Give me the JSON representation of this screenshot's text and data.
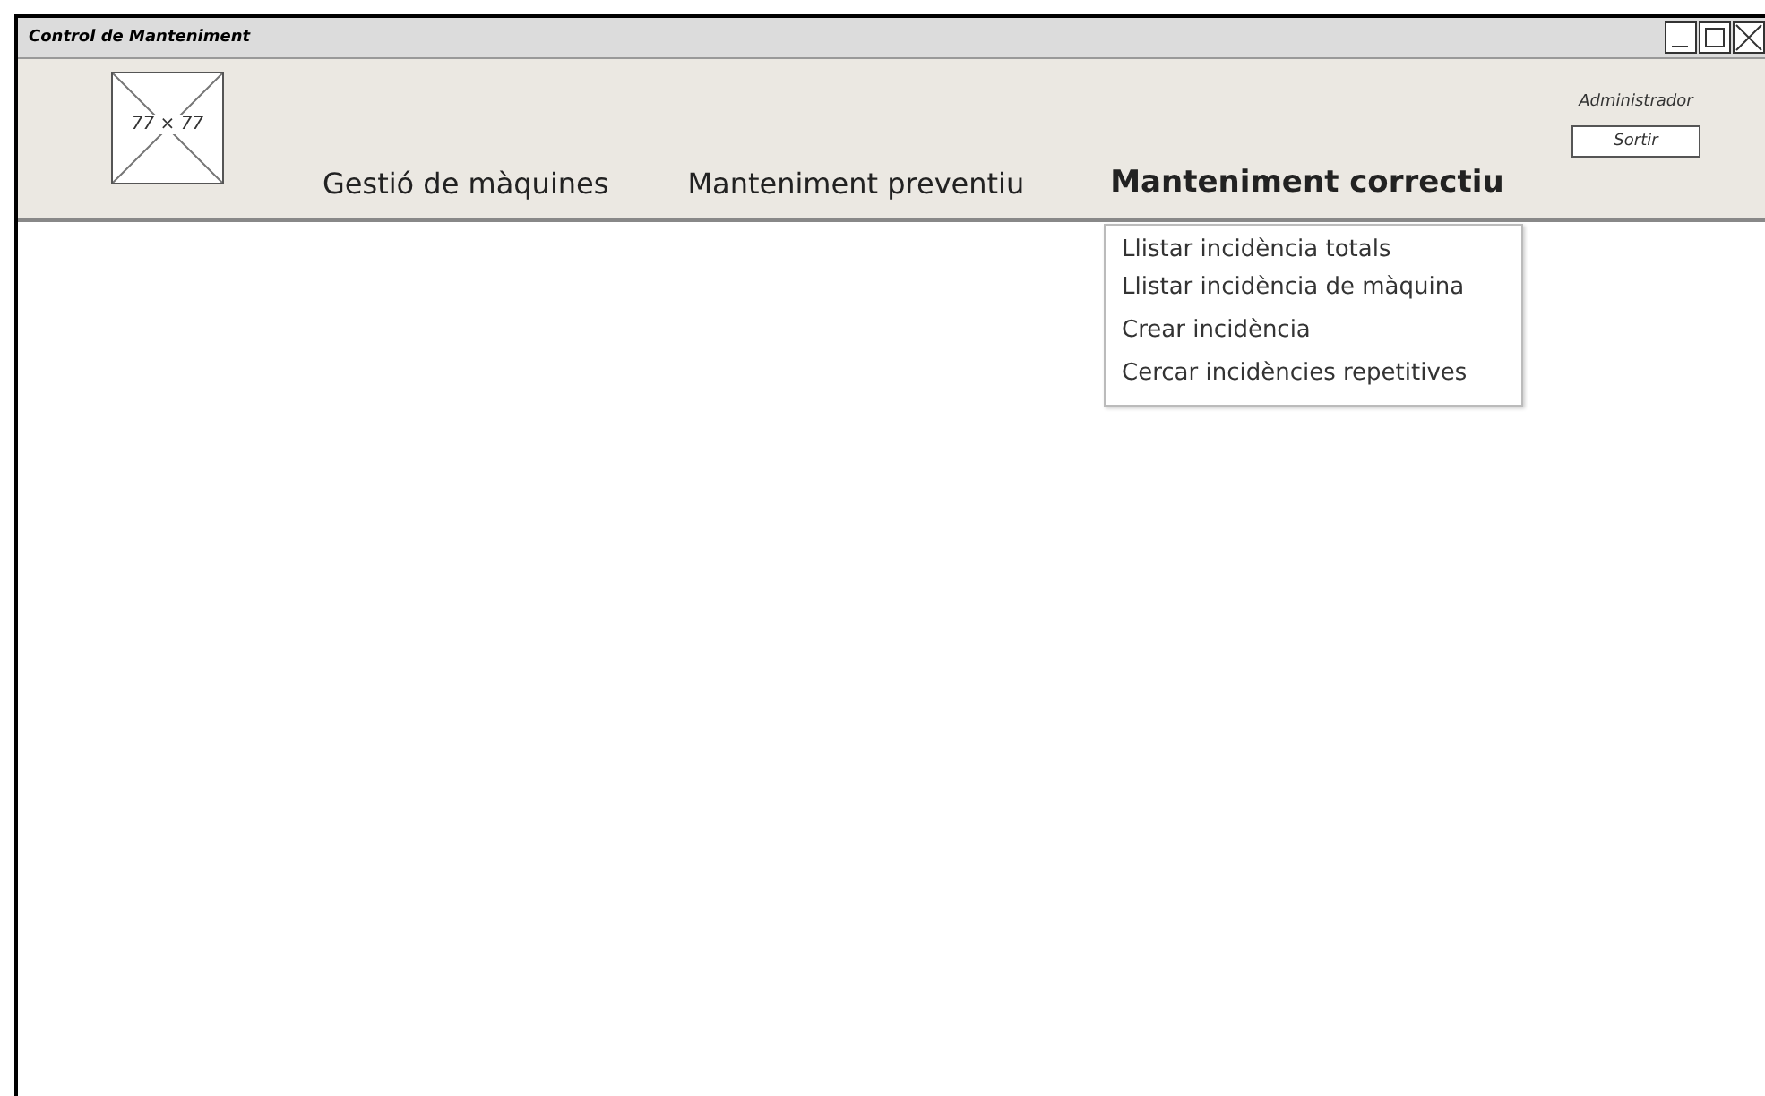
{
  "window": {
    "title": "Control de Manteniment"
  },
  "logo": {
    "label": "77 × 77"
  },
  "nav": [
    {
      "label": "Gestió de màquines",
      "selected": false
    },
    {
      "label": "Manteniment preventiu",
      "selected": false
    },
    {
      "label": "Manteniment correctiu",
      "selected": true,
      "menu": [
        "Llistar incidència totals",
        "Llistar incidència de màquina",
        "Crear incidència",
        "Cercar incidències repetitives"
      ]
    }
  ],
  "user": {
    "name": "Administrador",
    "logout": "Sortir"
  }
}
